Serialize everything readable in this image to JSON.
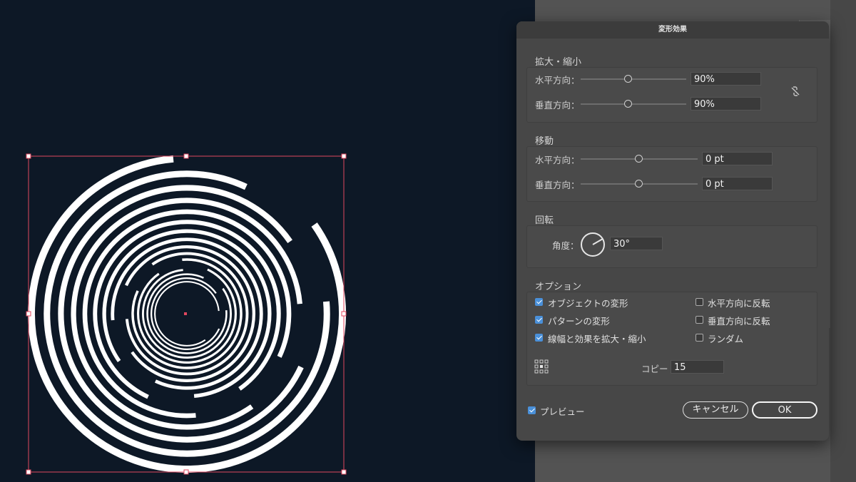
{
  "dialog": {
    "title": "変形効果",
    "scale": {
      "label": "拡大・縮小",
      "horizontal_label": "水平方向：",
      "horizontal_value": "90%",
      "vertical_label": "垂直方向：",
      "vertical_value": "90%"
    },
    "move": {
      "label": "移動",
      "horizontal_label": "水平方向：",
      "horizontal_value": "0 pt",
      "vertical_label": "垂直方向：",
      "vertical_value": "0 pt"
    },
    "rotate": {
      "label": "回転",
      "angle_label": "角度：",
      "angle_value": "30°"
    },
    "options": {
      "label": "オプション",
      "transform_objects": "オブジェクトの変形",
      "transform_patterns": "パターンの変形",
      "scale_strokes": "線幅と効果を拡大・縮小",
      "reflect_x": "水平方向に反転",
      "reflect_y": "垂直方向に反転",
      "random": "ランダム",
      "copies_label": "コピー",
      "copies_value": "15"
    },
    "preview_label": "プレビュー",
    "cancel_label": "キャンセル",
    "ok_label": "OK"
  },
  "icons": {
    "constrain": "link-broken-icon",
    "reference_point": "reference-point-grid-icon",
    "angle_dial": "angle-dial-icon"
  },
  "colors": {
    "canvas_background": "#0d1826",
    "selection": "#e0475f",
    "checkbox_checked": "#4a90d9"
  }
}
